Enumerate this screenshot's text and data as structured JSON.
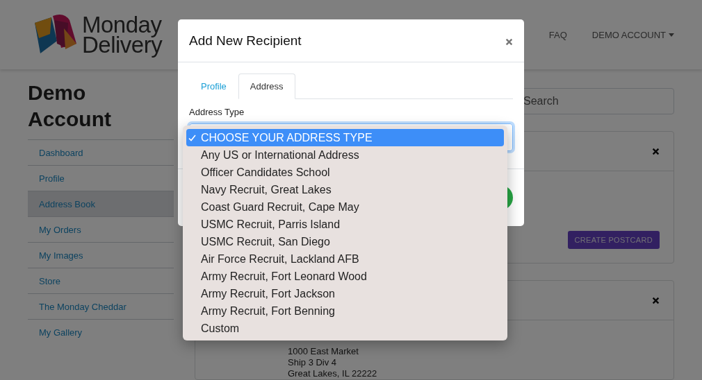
{
  "brand": {
    "line_1": "Monday",
    "line_2": "Delivery"
  },
  "nav": [
    {
      "label": "FAQ",
      "kind": "link"
    },
    {
      "label": "DEMO ACCOUNT",
      "kind": "dropdown"
    }
  ],
  "sidebar": {
    "title": "Demo Account",
    "items": [
      {
        "label": "Dashboard",
        "selected": false
      },
      {
        "label": "Profile",
        "selected": false
      },
      {
        "label": "Address Book",
        "selected": true
      },
      {
        "label": "My Orders",
        "selected": false
      },
      {
        "label": "My Images",
        "selected": false
      },
      {
        "label": "Store",
        "selected": false
      },
      {
        "label": "The Monday Cheddar",
        "selected": false
      },
      {
        "label": "My Gallery",
        "selected": false
      }
    ]
  },
  "search": {
    "placeholder": "Search"
  },
  "cards": [
    {
      "button": "CREATE POSTCARD"
    },
    {
      "address_lines": [
        "1000 East Market",
        "Ship 3 Div 4",
        "Great Lakes, IL 22222"
      ]
    }
  ],
  "modal": {
    "title": "Add New Recipient",
    "tabs": [
      {
        "label": "Profile",
        "selected": false
      },
      {
        "label": "Address",
        "selected": true
      }
    ],
    "field_label": "Address Type",
    "options": [
      {
        "label": "CHOOSE YOUR ADDRESS TYPE",
        "selected": true
      },
      {
        "label": "Any US or International Address",
        "selected": false
      },
      {
        "label": "Officer Candidates School",
        "selected": false
      },
      {
        "label": "Navy Recruit, Great Lakes",
        "selected": false
      },
      {
        "label": "Coast Guard Recruit, Cape May",
        "selected": false
      },
      {
        "label": "USMC Recruit, Parris Island",
        "selected": false
      },
      {
        "label": "USMC Recruit, San Diego",
        "selected": false
      },
      {
        "label": "Air Force Recruit, Lackland AFB",
        "selected": false
      },
      {
        "label": "Army Recruit, Fort Leonard Wood",
        "selected": false
      },
      {
        "label": "Army Recruit, Fort Jackson",
        "selected": false
      },
      {
        "label": "Army Recruit, Fort Benning",
        "selected": false
      },
      {
        "label": "Custom",
        "selected": false
      }
    ]
  }
}
